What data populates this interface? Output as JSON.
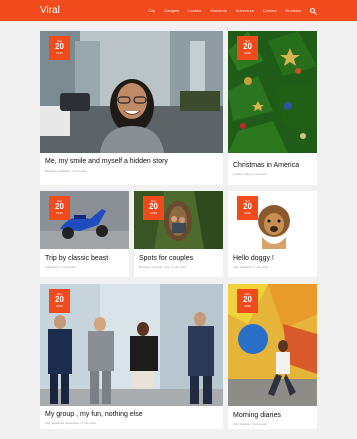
{
  "brand": "Viral",
  "nav": [
    "City",
    "Gadgets",
    "Lookbo",
    "Moments",
    "Adventure",
    "Cuisine",
    "Brooklyn"
  ],
  "cards": [
    {
      "month": "Nov",
      "day": "20",
      "year": "2016",
      "title": "Me, my smile and myself a hidden story",
      "meta": "Brooklyn, Gadgets / 1 min read"
    },
    {
      "month": "Nov",
      "day": "20",
      "year": "2016",
      "title": "Christmas in America",
      "meta": "Cuisine, City / 1 min read"
    },
    {
      "month": "Nov",
      "day": "20",
      "year": "2016",
      "title": "Trip by classic beast",
      "meta": "Adventure / 1 min read"
    },
    {
      "month": "Nov",
      "day": "20",
      "year": "2016",
      "title": "Spots for couples",
      "meta": "Brooklyn, Cuisine, City / 1 min read"
    },
    {
      "month": "Nov",
      "day": "20",
      "year": "2016",
      "title": "Hello doggy !",
      "meta": "City, Gadgets / 1 min read"
    },
    {
      "month": "Nov",
      "day": "20",
      "year": "2016",
      "title": "My group , my fun, nothing else",
      "meta": "City, Moments, adventure / 1 min read"
    },
    {
      "month": "Nov",
      "day": "20",
      "year": "2016",
      "title": "Morning diaries",
      "meta": "City, Cuisine / 1 min read"
    }
  ]
}
